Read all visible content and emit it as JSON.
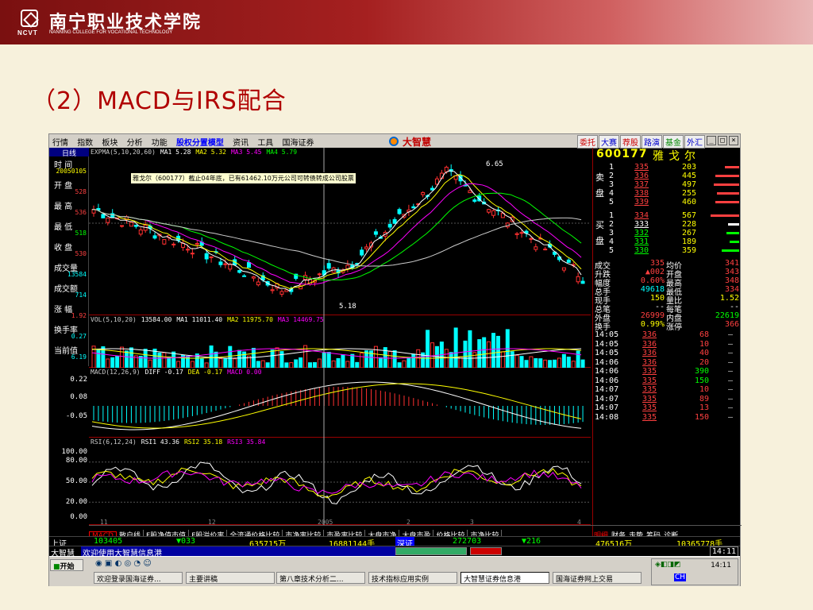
{
  "slide": {
    "title": "（2）MACD与IRS配合"
  },
  "banner": {
    "college_cn": "南宁职业技术学院",
    "college_en": "NANNING COLLEGE FOR VOCATIONAL TECHNOLOGY",
    "logo_abbr": "NCVT"
  },
  "app": {
    "menu": [
      "行情",
      "指数",
      "板块",
      "分析",
      "功能",
      "股权分置模型",
      "资讯",
      "工具",
      "国海证券"
    ],
    "brand": "大智慧",
    "quick_tabs": [
      "委托",
      "大赛",
      "荐股",
      "路演",
      "基金",
      "外汇"
    ],
    "window_buttons": [
      "_",
      "□",
      "×"
    ]
  },
  "left_panel": {
    "tab": "日线",
    "fields": [
      {
        "label": "时  间",
        "value": "20050105",
        "color": "#ffff00"
      },
      {
        "label": "开  盘",
        "value": "528",
        "color": "#ff4040"
      },
      {
        "label": "最  高",
        "value": "536",
        "color": "#ff4040"
      },
      {
        "label": "最  低",
        "value": "518",
        "color": "#00ff00"
      },
      {
        "label": "收  盘",
        "value": "530",
        "color": "#ff4040"
      },
      {
        "label": "成交量",
        "value": "13584",
        "color": "#00ffff"
      },
      {
        "label": "成交额",
        "value": "714",
        "color": "#00ffff"
      },
      {
        "label": "涨  幅",
        "value": "1.92",
        "color": "#ff4040"
      },
      {
        "label": "换手率",
        "value": "0.27",
        "color": "#00ffff"
      },
      {
        "label": "当前值",
        "value": "6.19",
        "color": "#00ffff"
      }
    ]
  },
  "price_panel": {
    "legend": [
      {
        "text": "EXPMA(5,10,20,60)",
        "color": "#cccccc"
      },
      {
        "text": "MA1  5.28",
        "color": "#ffffff"
      },
      {
        "text": "MA2  5.32",
        "color": "#ffff00"
      },
      {
        "text": "MA3  5.45",
        "color": "#ff00ff"
      },
      {
        "text": "MA4  5.79",
        "color": "#00ff00"
      }
    ],
    "tooltip": "雅戈尔（600177）截止04年底，已有61462.10万元公司可转债转成公司股票",
    "high_label": "6.65",
    "low_label": "5.18"
  },
  "volume_panel": {
    "legend": [
      {
        "text": "VOL(5,10,20)",
        "color": "#cccccc"
      },
      {
        "text": "13584.00",
        "color": "#ffffff"
      },
      {
        "text": "MA1  11011.40",
        "color": "#ffffff"
      },
      {
        "text": "MA2  11975.70",
        "color": "#ffff00"
      },
      {
        "text": "MA3  14469.75",
        "color": "#ff00ff"
      }
    ]
  },
  "macd_panel": {
    "legend": [
      {
        "text": "MACD(12,26,9)",
        "color": "#cccccc"
      },
      {
        "text": "DIFF  -0.17",
        "color": "#ffffff"
      },
      {
        "text": "DEA  -0.17",
        "color": "#ffff00"
      },
      {
        "text": "MACD  0.00",
        "color": "#ff00ff"
      }
    ],
    "y_labels": [
      "0.22",
      "0.08",
      "-0.05"
    ]
  },
  "rsi_panel": {
    "legend": [
      {
        "text": "RSI(6,12,24)",
        "color": "#cccccc"
      },
      {
        "text": "RSI1  43.36",
        "color": "#ffffff"
      },
      {
        "text": "RSI2  35.18",
        "color": "#ffff00"
      },
      {
        "text": "RSI3  35.84",
        "color": "#ff00ff"
      }
    ],
    "y_labels": [
      "100.00",
      "80.00",
      "50.00",
      "20.00",
      "0.00"
    ],
    "date_label": "2005",
    "month_ticks": [
      "11",
      "12",
      "2005",
      "2",
      "3",
      "4"
    ]
  },
  "quote": {
    "code": "600177",
    "name": "雅戈尔",
    "sell_label": "卖盘",
    "buy_label": "买盘",
    "sell": [
      {
        "lev": "5",
        "price": "339",
        "vol": "460",
        "bar": 30
      },
      {
        "lev": "4",
        "price": "338",
        "vol": "255",
        "bar": 28
      },
      {
        "lev": "3",
        "price": "337",
        "vol": "497",
        "bar": 32
      },
      {
        "lev": "2",
        "price": "336",
        "vol": "445",
        "bar": 30
      },
      {
        "lev": "1",
        "price": "335",
        "vol": "203",
        "bar": 18
      }
    ],
    "buy": [
      {
        "lev": "1",
        "price": "334",
        "vol": "567",
        "bar": 36
      },
      {
        "lev": "2",
        "price": "333",
        "vol": "228",
        "bar": 14
      },
      {
        "lev": "3",
        "price": "332",
        "vol": "267",
        "bar": 16
      },
      {
        "lev": "4",
        "price": "331",
        "vol": "189",
        "bar": 12
      },
      {
        "lev": "5",
        "price": "330",
        "vol": "359",
        "bar": 22
      }
    ],
    "stats": [
      {
        "l1": "成交",
        "v1": "335",
        "l2": "均价",
        "v2": "341"
      },
      {
        "l1": "升跌",
        "v1": "▲002",
        "l2": "开盘",
        "v2": "343"
      },
      {
        "l1": "幅度",
        "v1": "0.60%",
        "l2": "最高",
        "v2": "348"
      },
      {
        "l1": "总手",
        "v1": "49618",
        "l2": "最低",
        "v2": "334"
      },
      {
        "l1": "现手",
        "v1": "150",
        "l2": "量比",
        "v2": "1.52"
      },
      {
        "l1": "总笔",
        "v1": "--",
        "l2": "每笔",
        "v2": "--"
      },
      {
        "l1": "外盘",
        "v1": "26999",
        "l2": "内盘",
        "v2": "22619"
      },
      {
        "l1": "换手",
        "v1": "0.99%",
        "l2": "涨停",
        "v2": "366"
      }
    ],
    "ticks": [
      {
        "t": "14:05",
        "p": "336",
        "v": "68"
      },
      {
        "t": "14:05",
        "p": "336",
        "v": "10"
      },
      {
        "t": "14:05",
        "p": "336",
        "v": "40"
      },
      {
        "t": "14:06",
        "p": "336",
        "v": "20"
      },
      {
        "t": "14:06",
        "p": "335",
        "v": "390"
      },
      {
        "t": "14:06",
        "p": "335",
        "v": "150"
      },
      {
        "t": "14:07",
        "p": "335",
        "v": "10"
      },
      {
        "t": "14:07",
        "p": "335",
        "v": "89"
      },
      {
        "t": "14:07",
        "p": "335",
        "v": "13"
      },
      {
        "t": "14:08",
        "p": "335",
        "v": "150"
      }
    ]
  },
  "bottom_tabs": [
    "MACD",
    "散户线",
    "F股净值市值",
    "F股溢价率",
    "全流通价格比较",
    "市净率比较",
    "市盈率比较",
    "大盘市净",
    "大盘市盈",
    "价格比较",
    "市净比较"
  ],
  "right_tabs": [
    "明细",
    "财务",
    "走势",
    "筹码",
    "诊断"
  ],
  "status": {
    "market1": "上证",
    "index1": "103405",
    "chg1": "▼033",
    "amt1": "635715万",
    "vol1": "16881144手",
    "market2": "深证",
    "index2": "272703",
    "chg2": "▼216",
    "amt2": "476516万",
    "vol2": "10365778手",
    "brand": "大智慧",
    "ticker": "欢迎使用大智慧信息港",
    "clock": "14:11"
  },
  "taskbar": {
    "start": "开始",
    "time": "14:11",
    "ime": "CH",
    "tasks": [
      "欢迎登录国海证券...",
      "主要讲稿",
      "第八章技术分析二...",
      "技术指标应用实例",
      "大智慧证券信息港",
      "国海证券网上交易"
    ]
  }
}
